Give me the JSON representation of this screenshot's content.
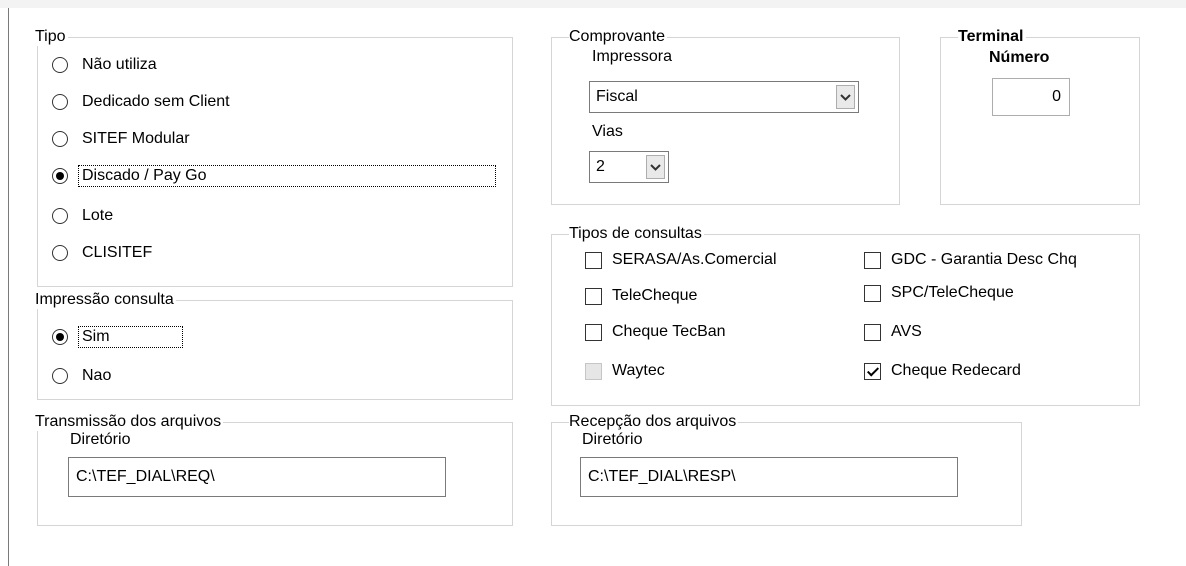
{
  "tipo": {
    "legend": "Tipo",
    "options": [
      {
        "label": "Não utiliza",
        "selected": false
      },
      {
        "label": "Dedicado sem Client",
        "selected": false
      },
      {
        "label": "SITEF Modular",
        "selected": false
      },
      {
        "label": "Discado / Pay Go",
        "selected": true
      },
      {
        "label": "Lote",
        "selected": false
      },
      {
        "label": "CLISITEF",
        "selected": false
      }
    ]
  },
  "impressao": {
    "legend": "Impressão consulta",
    "options": [
      {
        "label": "Sim",
        "selected": true
      },
      {
        "label": "Nao",
        "selected": false
      }
    ]
  },
  "transmissao": {
    "legend": "Transmissão dos arquivos",
    "dir_label": "Diretório",
    "dir_value": "C:\\TEF_DIAL\\REQ\\"
  },
  "comprovante": {
    "legend": "Comprovante",
    "impressora_label": "Impressora",
    "impressora_value": "Fiscal",
    "vias_label": "Vias",
    "vias_value": "2"
  },
  "terminal": {
    "legend": "Terminal",
    "numero_label": "Número",
    "numero_value": "0"
  },
  "consultas": {
    "legend": "Tipos de consultas",
    "left": [
      {
        "label": "SERASA/As.Comercial",
        "checked": false,
        "disabled": false
      },
      {
        "label": "TeleCheque",
        "checked": false,
        "disabled": false
      },
      {
        "label": "Cheque TecBan",
        "checked": false,
        "disabled": false
      },
      {
        "label": "Waytec",
        "checked": false,
        "disabled": true
      }
    ],
    "right": [
      {
        "label": "GDC - Garantia Desc Chq",
        "checked": false,
        "disabled": false
      },
      {
        "label": "SPC/TeleCheque",
        "checked": false,
        "disabled": false
      },
      {
        "label": "AVS",
        "checked": false,
        "disabled": false
      },
      {
        "label": "Cheque Redecard",
        "checked": true,
        "disabled": false
      }
    ]
  },
  "recepcao": {
    "legend": "Recepção dos arquivos",
    "dir_label": "Diretório",
    "dir_value": "C:\\TEF_DIAL\\RESP\\"
  }
}
